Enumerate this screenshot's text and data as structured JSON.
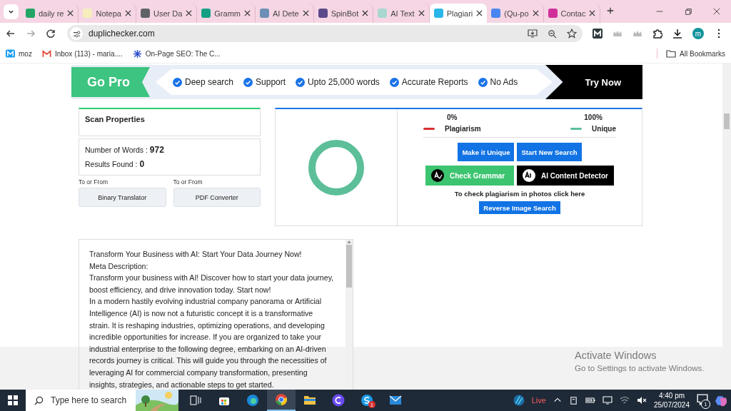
{
  "browser": {
    "tabs": [
      {
        "title": "daily re",
        "color": "#23a566",
        "selected": false
      },
      {
        "title": "Notepa",
        "color": "#f5eebc",
        "selected": false
      },
      {
        "title": "User Da",
        "color": "#5f6368",
        "selected": false
      },
      {
        "title": "Gramm",
        "color": "#15a085",
        "selected": false
      },
      {
        "title": "AI Dete",
        "color": "#6d8fb5",
        "selected": false
      },
      {
        "title": "SpinBot",
        "color": "#5a4a8a",
        "selected": false
      },
      {
        "title": "AI Text",
        "color": "#a8d8d0",
        "selected": false
      },
      {
        "title": "Plagiari",
        "color": "#29b6e8",
        "selected": true
      },
      {
        "title": "(Qu-po",
        "color": "#4a86f0",
        "selected": false
      },
      {
        "title": "Contac",
        "color": "#d0309a",
        "selected": false
      }
    ],
    "url": "duplichecker.com",
    "profile": "m",
    "bookmarks": [
      {
        "label": "moz"
      },
      {
        "label": "Inbox (113) - maria...."
      },
      {
        "label": "On-Page SEO: The C..."
      }
    ],
    "all_bookmarks": "All Bookmarks"
  },
  "promo": {
    "badge": "Go Pro",
    "features": [
      "Deep search",
      "Support",
      "Upto 25,000 words",
      "Accurate Reports",
      "No Ads"
    ],
    "cta": "Try Now"
  },
  "scan_properties": {
    "title": "Scan Properties",
    "words_label": "Number of Words :",
    "words": "972",
    "results_label": "Results Found :",
    "results": "0"
  },
  "tools": [
    {
      "caption": "To or From",
      "button": "Binary Translator"
    },
    {
      "caption": "To or From",
      "button": "PDF Converter"
    }
  ],
  "result": {
    "legend": [
      {
        "percent": "0%",
        "label": "Plagiarism",
        "color": "#d93030"
      },
      {
        "percent": "100%",
        "label": "Unique",
        "color": "#5cbf99"
      }
    ],
    "actions": [
      "Make it Unique",
      "Start New Search"
    ],
    "tools": [
      {
        "kind": "grammar",
        "label": "Check Grammar"
      },
      {
        "kind": "ai",
        "label": "AI Content Detector"
      }
    ],
    "photo_hint": "To check plagiarism in photos click here",
    "reverse": "Reverse Image Search"
  },
  "document": {
    "paragraphs": [
      "Transform Your Business with AI: Start Your Data Journey Now!",
      "Meta Description:",
      "Transform your business with AI! Discover how to start your data journey, boost efficiency, and drive innovation today. Start now!",
      "In a modern hastily evolving industrial company panorama or Artificial Intelligence (AI) is now not a futuristic concept it is a transformative strain. It is reshaping industries, optimizing operations, and developing incredible opportunities for increase. If you are organized to take your industrial enterprise to the following degree, embarking on an AI-driven records journey is critical. This will guide you through the necessities of leveraging AI for commercial company transformation, presenting insights, strategies, and actionable steps to get started."
    ]
  },
  "activation": {
    "title": "Activate Windows",
    "subtitle": "Go to Settings to activate Windows."
  },
  "taskbar": {
    "search_placeholder": "Type here to search",
    "skype_badge": "1",
    "weather": "Live",
    "time": "4:40 pm",
    "date": "25/07/2024",
    "notifications": "1"
  }
}
